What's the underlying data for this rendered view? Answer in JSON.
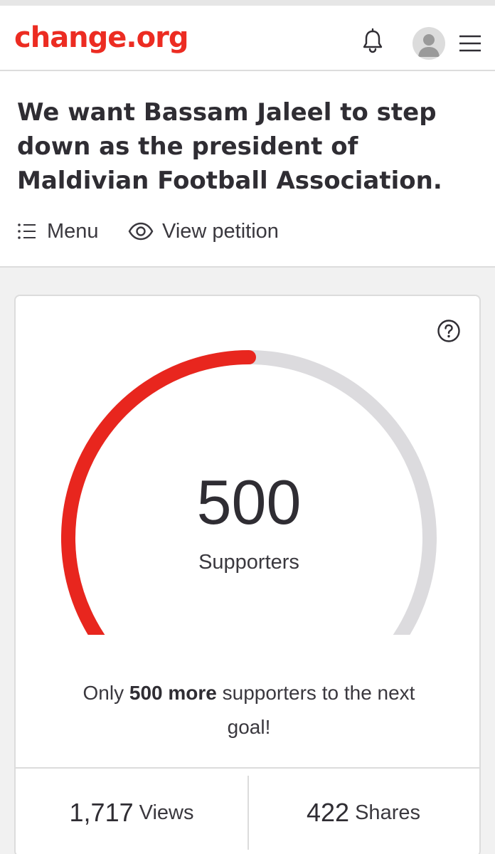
{
  "header": {
    "logo": "change.org",
    "bell_icon": "bell-icon",
    "avatar_icon": "user-avatar-icon",
    "menu_icon": "hamburger-icon"
  },
  "petition": {
    "title": "We want Bassam Jaleel to step down as the president of Maldivian Football Association.",
    "menu_label": "Menu",
    "view_label": "View petition"
  },
  "progress": {
    "count": "500",
    "count_label": "Supporters",
    "goal": 1000,
    "fraction": 0.5,
    "goal_prefix": "Only ",
    "goal_bold": "500 more",
    "goal_suffix": " supporters to the next goal!",
    "help_icon": "help-icon"
  },
  "stats": {
    "views_value": "1,717",
    "views_label": "Views",
    "shares_value": "422",
    "shares_label": "Shares"
  },
  "colors": {
    "brand": "#ec2c22",
    "gauge_fill": "#e8261e",
    "gauge_track": "#dcdbde",
    "text": "#2f2d33"
  }
}
